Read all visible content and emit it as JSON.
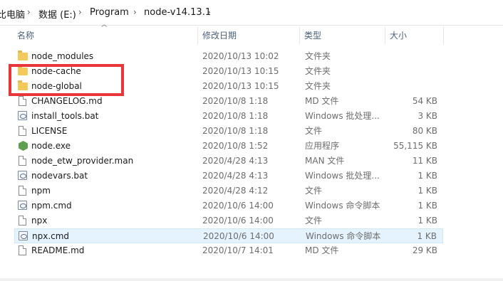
{
  "breadcrumb": {
    "items": [
      "比电脑",
      "数据 (E:)",
      "Program",
      "node-v14.13.1"
    ]
  },
  "columns": {
    "name": "名称",
    "date": "修改日期",
    "type": "类型",
    "size": "大小"
  },
  "files": [
    {
      "name": "node_modules",
      "date": "2020/10/13 10:02",
      "type": "文件夹",
      "size": "",
      "icon": "folder-icon"
    },
    {
      "name": "node-cache",
      "date": "2020/10/13 10:15",
      "type": "文件夹",
      "size": "",
      "icon": "folder-icon"
    },
    {
      "name": "node-global",
      "date": "2020/10/13 10:15",
      "type": "文件夹",
      "size": "",
      "icon": "folder-icon"
    },
    {
      "name": "CHANGELOG.md",
      "date": "2020/10/8 1:18",
      "type": "MD 文件",
      "size": "54 KB",
      "icon": "file-icon"
    },
    {
      "name": "install_tools.bat",
      "date": "2020/10/8 1:18",
      "type": "Windows 批处理...",
      "size": "3 KB",
      "icon": "gear-file-icon"
    },
    {
      "name": "LICENSE",
      "date": "2020/10/8 1:18",
      "type": "文件",
      "size": "80 KB",
      "icon": "file-icon"
    },
    {
      "name": "node.exe",
      "date": "2020/10/8 1:52",
      "type": "应用程序",
      "size": "55,115 KB",
      "icon": "node-icon"
    },
    {
      "name": "node_etw_provider.man",
      "date": "2020/4/28 4:13",
      "type": "MAN 文件",
      "size": "11 KB",
      "icon": "file-icon"
    },
    {
      "name": "nodevars.bat",
      "date": "2020/4/28 4:13",
      "type": "Windows 批处理...",
      "size": "1 KB",
      "icon": "gear-file-icon"
    },
    {
      "name": "npm",
      "date": "2020/4/28 4:12",
      "type": "文件",
      "size": "1 KB",
      "icon": "file-icon"
    },
    {
      "name": "npm.cmd",
      "date": "2020/10/6 14:00",
      "type": "Windows 命令脚本",
      "size": "1 KB",
      "icon": "gear-file-icon"
    },
    {
      "name": "npx",
      "date": "2020/10/6 14:00",
      "type": "文件",
      "size": "1 KB",
      "icon": "file-icon"
    },
    {
      "name": "npx.cmd",
      "date": "2020/10/6 14:00",
      "type": "Windows 命令脚本",
      "size": "1 KB",
      "icon": "gear-file-icon",
      "selected": true
    },
    {
      "name": "README.md",
      "date": "2020/10/7 14:01",
      "type": "MD 文件",
      "size": "29 KB",
      "icon": "file-icon"
    }
  ],
  "colors": {
    "highlight": "#e8363b",
    "selected_row": "#e5f3ff",
    "folder": "#f3c95c"
  }
}
